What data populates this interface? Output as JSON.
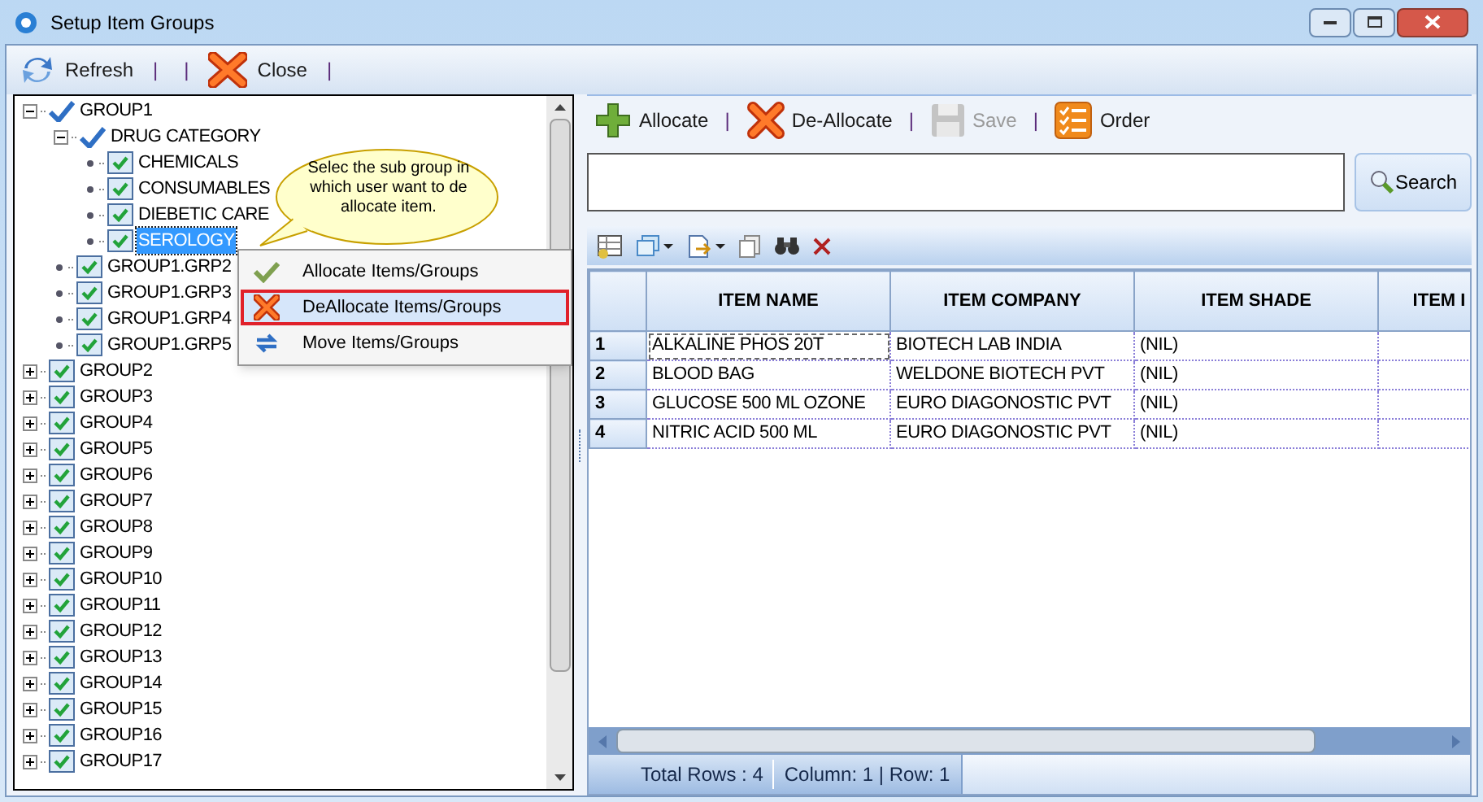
{
  "window": {
    "title": "Setup Item Groups"
  },
  "toolbar": [
    {
      "kind": "refresh",
      "label": "Refresh"
    },
    {
      "kind": "sep",
      "label": "|"
    },
    {
      "kind": "sep",
      "label": "|"
    },
    {
      "kind": "close",
      "label": "Close"
    },
    {
      "kind": "sep",
      "label": "|"
    }
  ],
  "tree": [
    {
      "label": "GROUP1",
      "checked": true,
      "partial": true,
      "expanded": true,
      "selected": false,
      "children": [
        {
          "label": "DRUG CATEGORY",
          "checked": true,
          "partial": true,
          "expanded": true,
          "selected": false,
          "children": [
            {
              "label": "CHEMICALS",
              "checked": true,
              "partial": false,
              "selected": false
            },
            {
              "label": "CONSUMABLES",
              "checked": true,
              "partial": false,
              "selected": false
            },
            {
              "label": "DIEBETIC CARE",
              "checked": true,
              "partial": false,
              "selected": false
            },
            {
              "label": "SEROLOGY",
              "checked": true,
              "partial": false,
              "selected": true
            }
          ]
        },
        {
          "label": "GROUP1.GRP2",
          "checked": true,
          "partial": false,
          "selected": false
        },
        {
          "label": "GROUP1.GRP3",
          "checked": true,
          "partial": false,
          "selected": false
        },
        {
          "label": "GROUP1.GRP4",
          "checked": true,
          "partial": false,
          "selected": false
        },
        {
          "label": "GROUP1.GRP5",
          "checked": true,
          "partial": false,
          "selected": false
        }
      ]
    },
    {
      "label": "GROUP2",
      "checked": true,
      "partial": false,
      "expanded": false,
      "selected": false
    },
    {
      "label": "GROUP3",
      "checked": true,
      "partial": false,
      "expanded": false,
      "selected": false
    },
    {
      "label": "GROUP4",
      "checked": true,
      "partial": false,
      "expanded": false,
      "selected": false
    },
    {
      "label": "GROUP5",
      "checked": true,
      "partial": false,
      "expanded": false,
      "selected": false
    },
    {
      "label": "GROUP6",
      "checked": true,
      "partial": false,
      "expanded": false,
      "selected": false
    },
    {
      "label": "GROUP7",
      "checked": true,
      "partial": false,
      "expanded": false,
      "selected": false
    },
    {
      "label": "GROUP8",
      "checked": true,
      "partial": false,
      "expanded": false,
      "selected": false
    },
    {
      "label": "GROUP9",
      "checked": true,
      "partial": false,
      "expanded": false,
      "selected": false
    },
    {
      "label": "GROUP10",
      "checked": true,
      "partial": false,
      "expanded": false,
      "selected": false
    },
    {
      "label": "GROUP11",
      "checked": true,
      "partial": false,
      "expanded": false,
      "selected": false
    },
    {
      "label": "GROUP12",
      "checked": true,
      "partial": false,
      "expanded": false,
      "selected": false
    },
    {
      "label": "GROUP13",
      "checked": true,
      "partial": false,
      "expanded": false,
      "selected": false
    },
    {
      "label": "GROUP14",
      "checked": true,
      "partial": false,
      "expanded": false,
      "selected": false
    },
    {
      "label": "GROUP15",
      "checked": true,
      "partial": false,
      "expanded": false,
      "selected": false
    },
    {
      "label": "GROUP16",
      "checked": true,
      "partial": false,
      "expanded": false,
      "selected": false
    },
    {
      "label": "GROUP17",
      "checked": true,
      "partial": false,
      "expanded": false,
      "selected": false
    }
  ],
  "callout": {
    "text": "Selec the sub group in which user want to de allocate item."
  },
  "context_menu": [
    {
      "kind": "allocate",
      "label": "Allocate Items/Groups",
      "selected": false
    },
    {
      "kind": "deallocate",
      "label": "DeAllocate Items/Groups",
      "selected": true
    },
    {
      "kind": "move",
      "label": "Move Items/Groups",
      "selected": false
    }
  ],
  "actions": [
    {
      "kind": "allocate",
      "label": "Allocate",
      "disabled": false
    },
    {
      "kind": "sep",
      "label": "|"
    },
    {
      "kind": "deallocate",
      "label": "De-Allocate",
      "disabled": false
    },
    {
      "kind": "sep",
      "label": "|"
    },
    {
      "kind": "save",
      "label": "Save",
      "disabled": true
    },
    {
      "kind": "sep",
      "label": "|"
    },
    {
      "kind": "order",
      "label": "Order",
      "disabled": false
    }
  ],
  "search": {
    "button": "Search"
  },
  "table": {
    "columns": [
      "ITEM NAME",
      "ITEM COMPANY",
      "ITEM SHADE",
      "ITEM I"
    ],
    "rows": [
      {
        "number": "1",
        "cells": [
          "ALKALINE PHOS 20T",
          "BIOTECH LAB INDIA",
          "(NIL)"
        ]
      },
      {
        "number": "2",
        "cells": [
          "BLOOD BAG",
          "WELDONE BIOTECH PVT",
          "(NIL)"
        ]
      },
      {
        "number": "3",
        "cells": [
          "GLUCOSE 500 ML OZONE",
          "EURO DIAGONOSTIC PVT",
          "(NIL)"
        ]
      },
      {
        "number": "4",
        "cells": [
          "NITRIC ACID 500 ML",
          "EURO DIAGONOSTIC PVT",
          "(NIL)"
        ]
      }
    ]
  },
  "status_bar": {
    "total": "Total Rows : 4",
    "position": "Column: 1 | Row: 1"
  }
}
